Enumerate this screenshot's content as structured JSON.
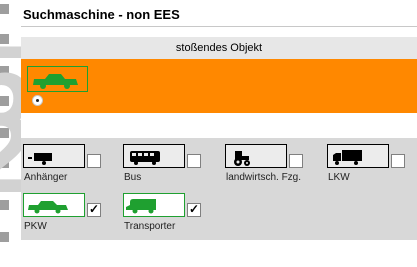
{
  "title": "Suchmaschine - non EES",
  "section_header": "stoßendes Objekt",
  "selected": {
    "icon": "green-car-icon",
    "radio_selected": true
  },
  "colors": {
    "selected_bg": "#ff8800",
    "active_icon": "#1fa030",
    "header_bg": "#e7e7e7",
    "grid_bg": "#d8d8d8"
  },
  "options": [
    {
      "label": "Anhänger",
      "icon": "trailer-icon",
      "checked": false
    },
    {
      "label": "Bus",
      "icon": "bus-icon",
      "checked": false
    },
    {
      "label": "landwirtsch. Fzg.",
      "icon": "tractor-icon",
      "checked": false
    },
    {
      "label": "LKW",
      "icon": "truck-icon",
      "checked": false
    },
    {
      "label": "PKW",
      "icon": "car-icon",
      "checked": true
    },
    {
      "label": "Transporter",
      "icon": "van-icon",
      "checked": true
    }
  ]
}
